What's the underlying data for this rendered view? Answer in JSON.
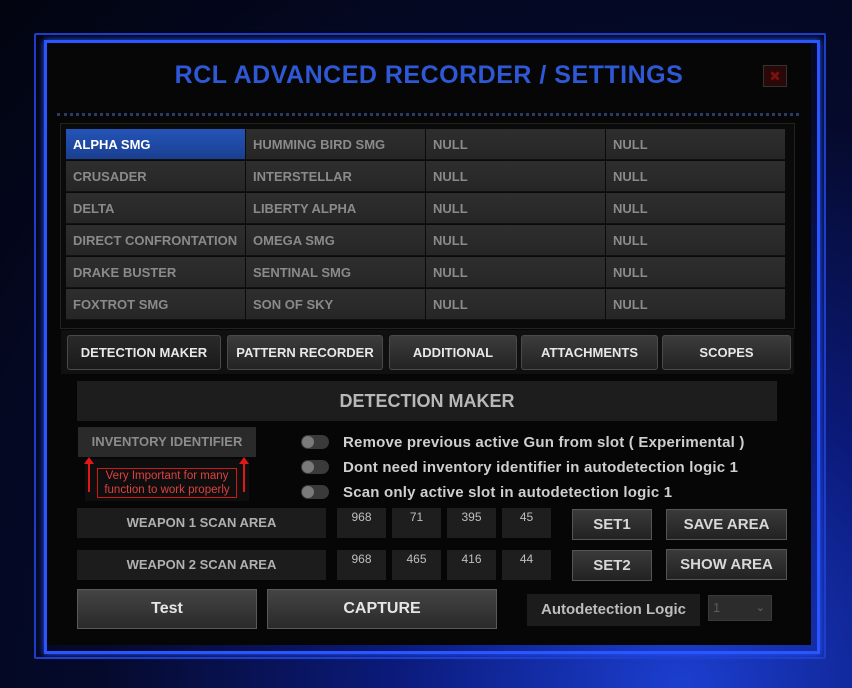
{
  "window": {
    "title": "RCL  ADVANCED RECORDER / SETTINGS",
    "close_label": "✖"
  },
  "guns": {
    "columns": [
      [
        "ALPHA SMG",
        "CRUSADER",
        "DELTA",
        "DIRECT CONFRONTATION",
        "DRAKE BUSTER",
        "FOXTROT SMG"
      ],
      [
        "HUMMING BIRD SMG",
        "INTERSTELLAR",
        "LIBERTY ALPHA",
        "OMEGA SMG",
        "SENTINAL SMG",
        "SON OF SKY"
      ],
      [
        "NULL",
        "NULL",
        "NULL",
        "NULL",
        "NULL",
        "NULL"
      ],
      [
        "NULL",
        "NULL",
        "NULL",
        "NULL",
        "NULL",
        "NULL"
      ]
    ],
    "selected": "ALPHA SMG"
  },
  "tabs": [
    "DETECTION MAKER",
    "PATTERN RECORDER",
    "ADDITIONAL",
    "ATTACHMENTS",
    "SCOPES"
  ],
  "active_tab": "DETECTION MAKER",
  "detection": {
    "header": "DETECTION MAKER",
    "inventory_button": "INVENTORY IDENTIFIER",
    "warning": "Very Important for many function to work properly",
    "toggles": [
      "Remove previous active Gun from slot ( Experimental )",
      "Dont need inventory identifier in autodetection logic 1",
      "Scan only active slot in autodetection logic 1"
    ],
    "weapon1": {
      "label": "WEAPON 1 SCAN AREA",
      "values": [
        "968",
        "71",
        "395",
        "45"
      ]
    },
    "weapon2": {
      "label": "WEAPON 2 SCAN AREA",
      "values": [
        "968",
        "465",
        "416",
        "44"
      ]
    },
    "set1": "SET1",
    "set2": "SET2",
    "save_area": "SAVE AREA",
    "show_area": "SHOW AREA",
    "test": "Test",
    "capture": "CAPTURE",
    "autodetection_label": "Autodetection Logic",
    "autodetection_value": "1"
  },
  "colors": {
    "title": "#2f58d6",
    "selected": "#2454b8",
    "warning": "#e01818"
  }
}
